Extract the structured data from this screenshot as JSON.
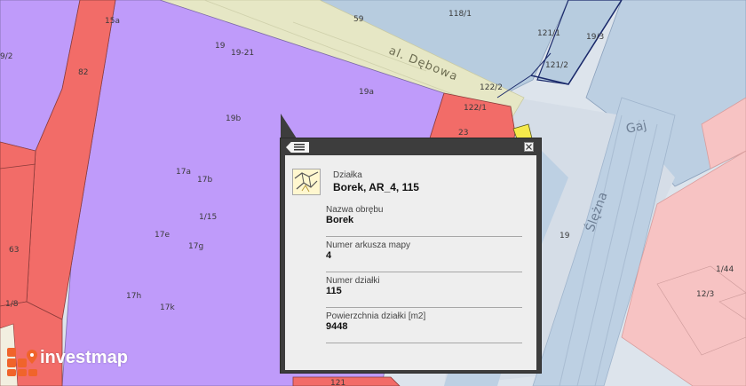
{
  "map": {
    "street_name": "al. Dębowa",
    "place_name": "Gaj",
    "road_name": "Ślężna",
    "parcel_labels": [
      "15a",
      "82",
      "9/2",
      "63",
      "1/8",
      "19",
      "19-21",
      "19a",
      "19b",
      "17a",
      "17b",
      "17e",
      "17g",
      "17h",
      "17k",
      "1/15",
      "23",
      "122/1",
      "122/2",
      "121/1",
      "121/2",
      "118/1",
      "19/3",
      "19",
      "1/44",
      "12/3",
      "59",
      "121"
    ],
    "colors": {
      "purple": "#bf9bfa",
      "red": "#f26c68",
      "pink": "#f7c3c3",
      "yellow_road": "#e6e7c5",
      "blue_road": "#bacfe1",
      "gray_street": "#d5dde7",
      "yellow_accent": "#f5e94b"
    }
  },
  "popup": {
    "icons": {
      "menu": "list-menu-icon",
      "close": "close-icon",
      "parcel": "parcel-map-icon"
    },
    "title_label": "Działka",
    "title_value": "Borek, AR_4, 115",
    "fields": [
      {
        "label": "Nazwa obrębu",
        "value": "Borek"
      },
      {
        "label": "Numer arkusza mapy",
        "value": "4"
      },
      {
        "label": "Numer działki",
        "value": "115"
      },
      {
        "label": "Powierzchnia działki [m2]",
        "value": "9448"
      }
    ]
  },
  "brand": {
    "name": "investmap",
    "logo_icon": "investmap-logo-icon",
    "logo_color": "#f0642b"
  }
}
